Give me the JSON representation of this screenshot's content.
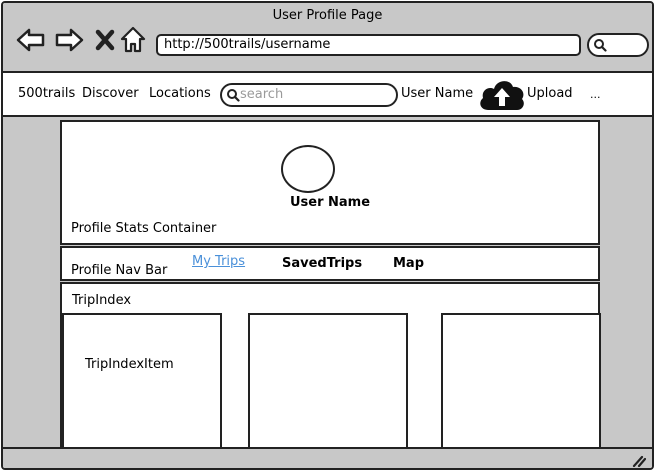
{
  "window": {
    "title": "User Profile Page"
  },
  "browser": {
    "url": "http://500trails/username",
    "nav_icons": [
      "back-arrow-icon",
      "forward-arrow-icon",
      "close-x-icon",
      "home-icon"
    ]
  },
  "topnav": {
    "brand": "500trails",
    "links": [
      "Discover",
      "Locations"
    ],
    "search_placeholder": "search",
    "user_name": "User Name",
    "upload_label": "Upload",
    "more": "..."
  },
  "profile": {
    "user_name": "User Name",
    "stats_label": "Profile Stats Container",
    "nav_label": "Profile Nav Bar",
    "tabs": [
      "My Trips",
      "SavedTrips",
      "Map"
    ],
    "active_tab": "My Trips"
  },
  "trip_index": {
    "label": "TripIndex",
    "items": [
      {
        "label": "TripIndexItem"
      },
      {
        "label": ""
      },
      {
        "label": ""
      }
    ]
  },
  "colors": {
    "chrome": "#c8c8c8",
    "active_tab": "#4a90d9",
    "stroke": "#222222"
  }
}
